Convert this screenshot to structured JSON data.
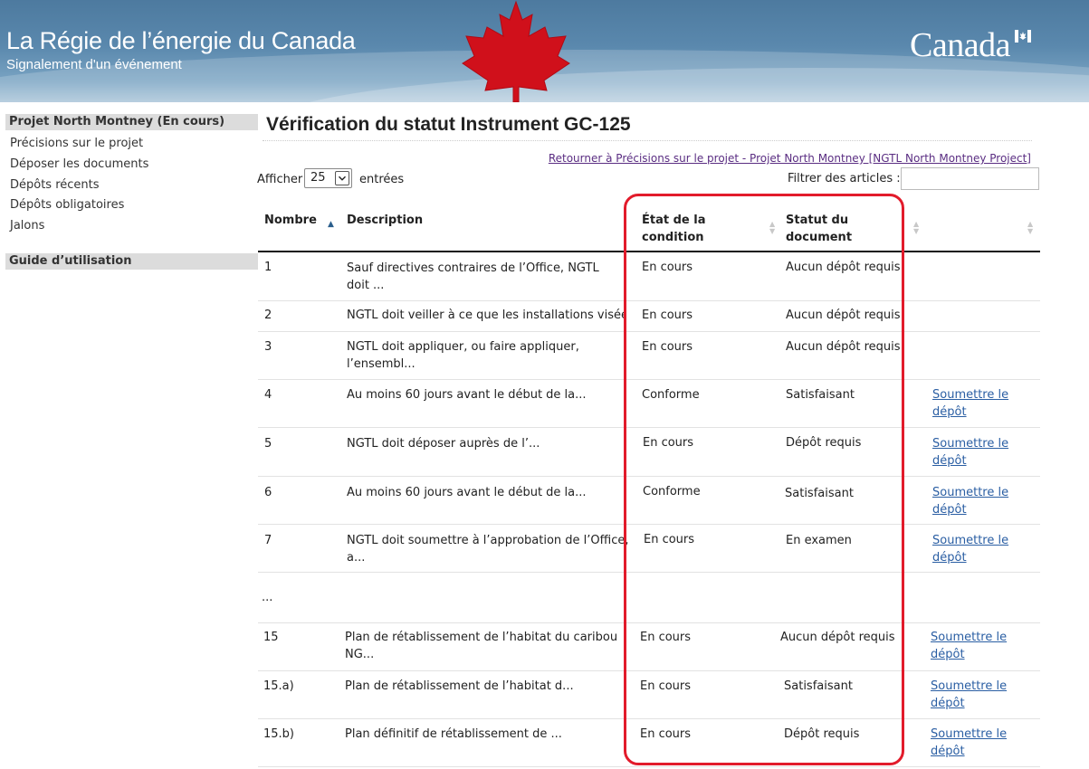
{
  "header": {
    "title": "La Régie de l’énergie du Canada",
    "subtitle": "Signalement d'un événement",
    "wordmark": "Canada"
  },
  "sidebar": {
    "project_heading": "Projet North Montney (En cours)",
    "items": [
      {
        "label": "Précisions sur le projet"
      },
      {
        "label": "Déposer les documents"
      },
      {
        "label": "Dépôts récents"
      },
      {
        "label": "Dépôts obligatoires"
      },
      {
        "label": "Jalons"
      }
    ],
    "guide_heading": "Guide d’utilisation"
  },
  "main": {
    "title": "Vérification du statut Instrument GC-125",
    "return_link": "Retourner à Précisions sur le projet - Projet North Montney [NGTL North Montney Project]",
    "show_label": "Afficher",
    "page_size": "25",
    "entries_label": "entrées",
    "filter_label": "Filtrer des articles :",
    "filter_value": ""
  },
  "table": {
    "headers": {
      "number": "Nombre",
      "description": "Description",
      "condition_line1": "État de la",
      "condition_line2": "condition",
      "status_line1": "Statut du",
      "status_line2": "document"
    },
    "rows": [
      {
        "number": "1",
        "desc1": "Sauf directives contraires de l’Office, NGTL",
        "desc2": "doit ...",
        "condition": "En cours",
        "status": "Aucun dépôt requis",
        "action1": "",
        "action2": ""
      },
      {
        "number": "2",
        "desc1": "NGTL doit veiller à ce que les installations visée...",
        "desc2": "",
        "condition": "En cours",
        "status": "Aucun dépôt requis",
        "action1": "",
        "action2": ""
      },
      {
        "number": "3",
        "desc1": "NGTL doit appliquer, ou faire appliquer,",
        "desc2": "l’ensembl...",
        "condition": "En cours",
        "status": "Aucun dépôt requis",
        "action1": "",
        "action2": ""
      },
      {
        "number": "4",
        "desc1": "Au moins 60 jours avant le début de la...",
        "desc2": "",
        "condition": "Conforme",
        "status": "Satisfaisant",
        "action1": "Soumettre le",
        "action2": "dépôt"
      },
      {
        "number": "5",
        "desc1": "NGTL doit déposer auprès de l’...",
        "desc2": "",
        "condition": "En cours",
        "status": "Dépôt requis",
        "action1": "Soumettre le",
        "action2": "dépôt"
      },
      {
        "number": "6",
        "desc1": "Au moins 60 jours avant le début de la...",
        "desc2": "",
        "condition": "Conforme",
        "status": "Satisfaisant",
        "action1": "Soumettre le",
        "action2": "dépôt"
      },
      {
        "number": "7",
        "desc1": "NGTL doit soumettre à l’approbation de l’Office,",
        "desc2": "a...",
        "condition": "En cours",
        "status": "En examen",
        "action1": "Soumettre le",
        "action2": "dépôt"
      },
      {
        "number": "...",
        "desc1": "",
        "desc2": "",
        "condition": "",
        "status": "",
        "action1": "",
        "action2": ""
      },
      {
        "number": "15",
        "desc1": "Plan de rétablissement de l’habitat du caribou",
        "desc2": "NG...",
        "condition": "En cours",
        "status": "Aucun dépôt requis",
        "action1": "Soumettre le",
        "action2": "dépôt"
      },
      {
        "number": "15.a)",
        "desc1": "Plan de rétablissement de l’habitat d...",
        "desc2": "",
        "condition": "En cours",
        "status": "Satisfaisant",
        "action1": "Soumettre le",
        "action2": "dépôt"
      },
      {
        "number": "15.b)",
        "desc1": "Plan définitif de rétablissement de ...",
        "desc2": "",
        "condition": "En cours",
        "status": "Dépôt requis",
        "action1": "Soumettre le",
        "action2": "dépôt"
      }
    ]
  },
  "colors": {
    "highlight": "#e21b2b",
    "link": "#2a5ea3",
    "visited_link": "#5a2d82",
    "banner": "#5a88ad"
  },
  "icons": [
    "maple-leaf-icon",
    "canada-flag-icon",
    "sort-asc-icon",
    "sort-both-icon",
    "dropdown-caret-icon"
  ]
}
